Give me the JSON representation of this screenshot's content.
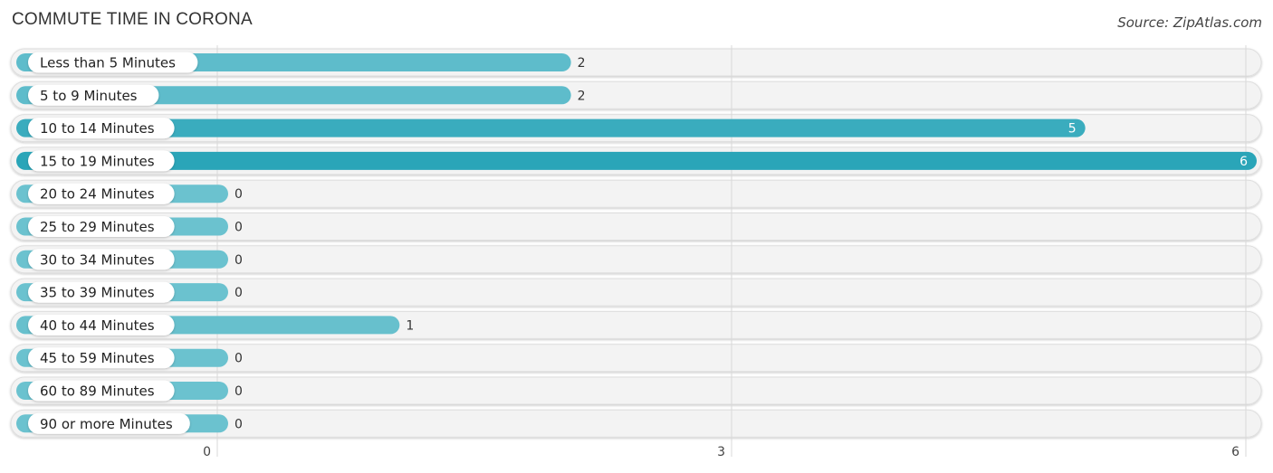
{
  "header": {
    "title": "COMMUTE TIME IN CORONA",
    "source": "Source: ZipAtlas.com"
  },
  "colors": {
    "bar_low": "#6bc2cf",
    "bar_high": "#2aa5b8",
    "track": "#f3f3f3",
    "grid": "#d8d8d8"
  },
  "chart_data": {
    "type": "bar",
    "orientation": "horizontal",
    "title": "COMMUTE TIME IN CORONA",
    "xlabel": "",
    "ylabel": "",
    "categories": [
      "Less than 5 Minutes",
      "5 to 9 Minutes",
      "10 to 14 Minutes",
      "15 to 19 Minutes",
      "20 to 24 Minutes",
      "25 to 29 Minutes",
      "30 to 34 Minutes",
      "35 to 39 Minutes",
      "40 to 44 Minutes",
      "45 to 59 Minutes",
      "60 to 89 Minutes",
      "90 or more Minutes"
    ],
    "values": [
      2,
      2,
      5,
      6,
      0,
      0,
      0,
      0,
      1,
      0,
      0,
      0
    ],
    "xlim": [
      0,
      6
    ],
    "xticks": [
      0,
      3,
      6
    ],
    "grid": true,
    "legend": "none"
  }
}
